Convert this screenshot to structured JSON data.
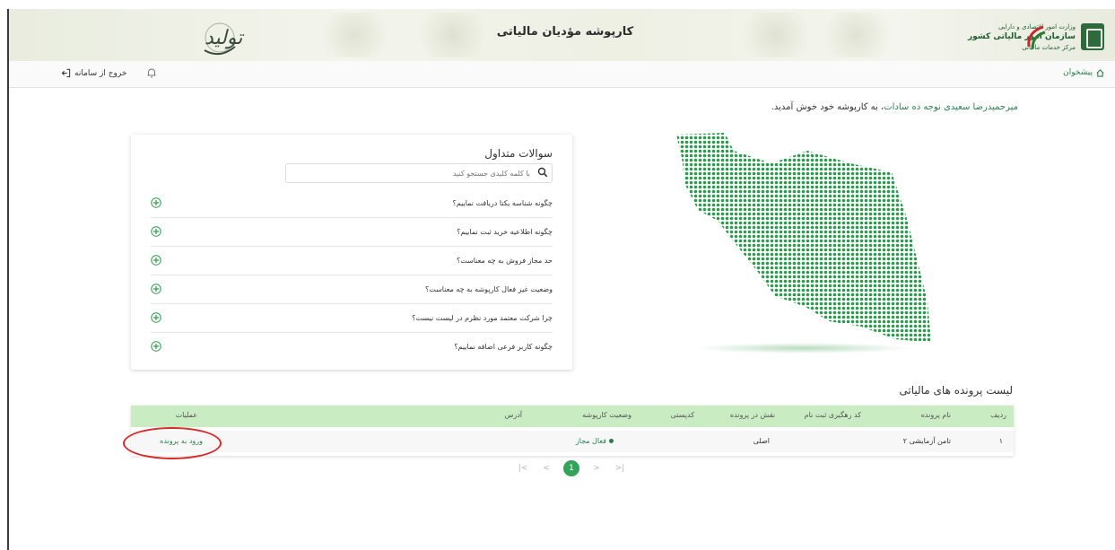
{
  "header": {
    "title": "کارپوشه مؤدیان مالیاتی",
    "org_line1": "وزارت امور اقتصادی و دارایی",
    "org_line2": "سازمان امور مالیاتی کشور",
    "org_line3": "مرکز خدمات مالیاتی",
    "slogan_logo": "تولید"
  },
  "toolbar": {
    "home_label": "پیشخوان",
    "logout_label": "خروج از سامانه"
  },
  "welcome": {
    "name": "میرحمیدرضا سعیدی نوجه ده سادات",
    "suffix": "، به کارپوشه خود خوش آمدید."
  },
  "faq": {
    "title": "سوالات متداول",
    "search_placeholder": "با کلمه کلیدی جستجو کنید",
    "items": [
      "چگونه شناسه یکتا دریافت نماییم؟",
      "چگونه اطلاعیه خرید ثبت نماییم؟",
      "حد مجاز فروش به چه معناست؟",
      "وضعیت غیر فعال کارپوشه به چه معناست؟",
      "چرا شرکت معتمد مورد نظرم در لیست نیست؟",
      "چگونه کاربر فرعی اضافه نماییم؟"
    ]
  },
  "files": {
    "title": "لیست پرونده های مالیاتی",
    "columns": {
      "row": "ردیف",
      "name": "نام پرونده",
      "tracking": "کد رهگیری ثبت نام",
      "role": "نقش در پرونده",
      "postal": "کدپستی",
      "status": "وضعیت کارپوشه",
      "address": "آدرس",
      "actions": "عملیات"
    },
    "rows": [
      {
        "row": "۱",
        "name": "تامن آزمایشی ۲",
        "tracking": "",
        "role": "اصلی",
        "postal": "",
        "status": "فعال مجاز",
        "address": "",
        "action": "ورود به پرونده"
      }
    ]
  },
  "pagination": {
    "first": "|<",
    "prev": "<",
    "current": "1",
    "next": ">",
    "last": ">|"
  },
  "colors": {
    "accent": "#33a35a",
    "header_row": "#c9ecc3",
    "annotation": "#d62b2b",
    "map_dots": "#2f9a4f"
  }
}
